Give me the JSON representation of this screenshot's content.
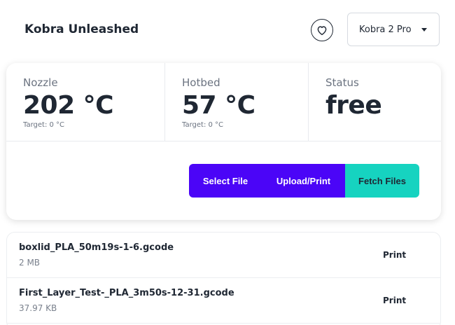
{
  "header": {
    "title": "Kobra Unleashed",
    "favorite_icon": "heart-icon",
    "printer_select": {
      "selected": "Kobra 2 Pro",
      "icon": "caret-down-icon"
    }
  },
  "stats": {
    "nozzle": {
      "label": "Nozzle",
      "value": "202 °C",
      "target": "Target: 0 °C"
    },
    "hotbed": {
      "label": "Hotbed",
      "value": "57 °C",
      "target": "Target: 0 °C"
    },
    "status": {
      "label": "Status",
      "value": "free"
    }
  },
  "actions": {
    "select_file": "Select File",
    "upload_print": "Upload/Print",
    "fetch_files": "Fetch Files"
  },
  "files": [
    {
      "name": "boxlid_PLA_50m19s-1-6.gcode",
      "size": "2 MB",
      "action": "Print"
    },
    {
      "name": "First_Layer_Test-_PLA_3m50s-12-31.gcode",
      "size": "37.97 KB",
      "action": "Print"
    }
  ],
  "colors": {
    "primary": "#4b05f7",
    "accent": "#16d3c0",
    "text": "#1f2733"
  }
}
